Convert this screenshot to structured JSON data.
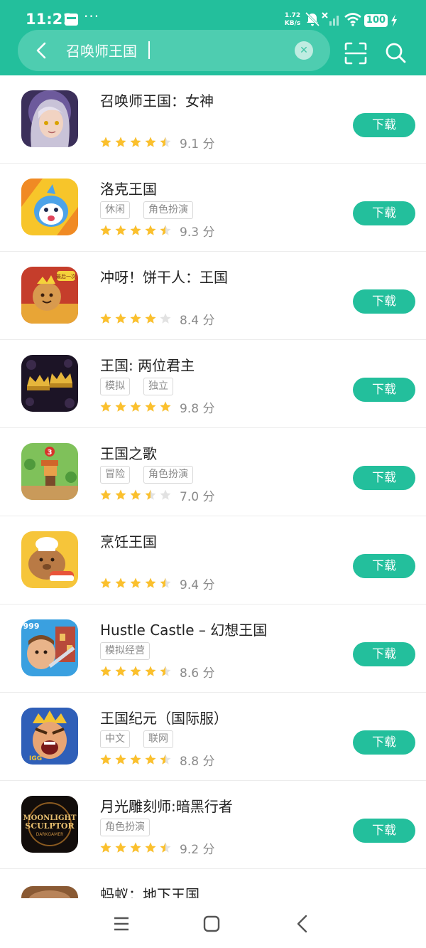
{
  "status": {
    "time": "11:21",
    "dots": "···",
    "speed_value": "1.72",
    "speed_unit": "KB/s",
    "battery": "100"
  },
  "search": {
    "query": "召唤师王国"
  },
  "colors": {
    "accent": "#23bf9c",
    "star": "#fbc02d",
    "star_empty": "#e2e2e2"
  },
  "apps": [
    {
      "name": "召唤师王国：女神",
      "tags": [],
      "rating": 4.5,
      "score": "9.1 分",
      "download": "下载"
    },
    {
      "name": "洛克王国",
      "tags": [
        "休闲",
        "角色扮演"
      ],
      "rating": 4.5,
      "score": "9.3 分",
      "download": "下载"
    },
    {
      "name": "冲呀！饼干人：王国",
      "tags": [],
      "rating": 4,
      "score": "8.4 分",
      "download": "下载"
    },
    {
      "name": "王国: 两位君主",
      "tags": [
        "模拟",
        "独立"
      ],
      "rating": 5,
      "score": "9.8 分",
      "download": "下载"
    },
    {
      "name": "王国之歌",
      "tags": [
        "冒险",
        "角色扮演"
      ],
      "rating": 3.5,
      "score": "7.0 分",
      "download": "下载"
    },
    {
      "name": "烹饪王国",
      "tags": [],
      "rating": 4.5,
      "score": "9.4 分",
      "download": "下载"
    },
    {
      "name": "Hustle Castle – 幻想王国",
      "tags": [
        "模拟经营"
      ],
      "rating": 4.5,
      "score": "8.6 分",
      "download": "下载"
    },
    {
      "name": "王国纪元（国际服）",
      "tags": [
        "中文",
        "联网"
      ],
      "rating": 4.5,
      "score": "8.8 分",
      "download": "下载"
    },
    {
      "name": "月光雕刻师:暗黑行者",
      "tags": [
        "角色扮演"
      ],
      "rating": 4.5,
      "score": "9.2 分",
      "download": "下载"
    },
    {
      "name": "蚂蚁：地下王国",
      "tags": [],
      "rating": 0,
      "score": "",
      "download": ""
    }
  ],
  "icon_texts": {
    "cookie_badge": "最后一次",
    "kingdom_song_badge": "3",
    "hustle_count": "999",
    "lords_logo": "IGG",
    "moonlight_logo_1": "MOONLIGHT",
    "moonlight_logo_2": "SCULPTOR",
    "moonlight_logo_3": "DARKGAMER"
  }
}
